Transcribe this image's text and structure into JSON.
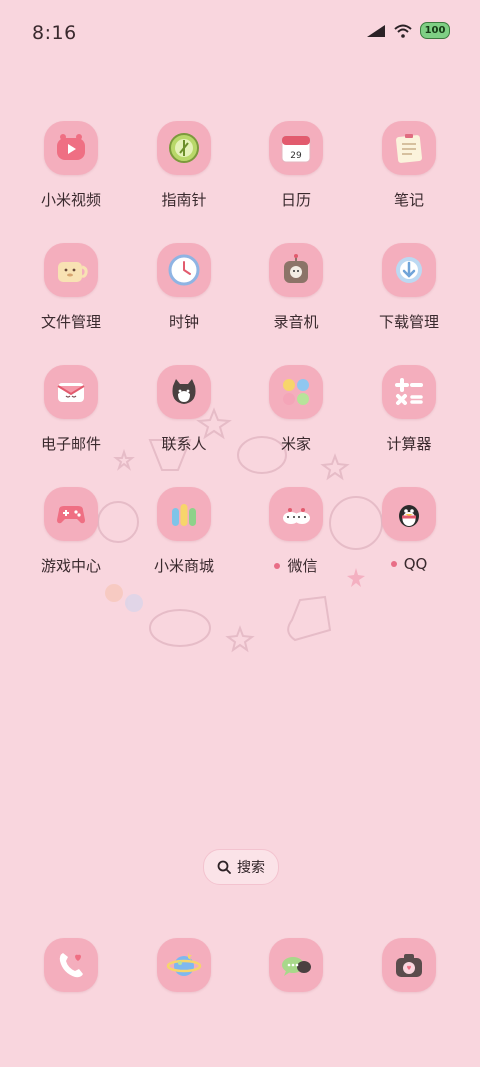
{
  "status_bar": {
    "time": "8:16",
    "battery": "100"
  },
  "apps": [
    {
      "label": "小米视频",
      "icon": "video-icon"
    },
    {
      "label": "指南针",
      "icon": "compass-icon"
    },
    {
      "label": "日历",
      "icon": "calendar-icon",
      "date": "29"
    },
    {
      "label": "笔记",
      "icon": "notes-icon"
    },
    {
      "label": "文件管理",
      "icon": "folder-icon"
    },
    {
      "label": "时钟",
      "icon": "clock-icon"
    },
    {
      "label": "录音机",
      "icon": "recorder-icon"
    },
    {
      "label": "下载管理",
      "icon": "download-icon"
    },
    {
      "label": "电子邮件",
      "icon": "mail-icon"
    },
    {
      "label": "联系人",
      "icon": "contacts-icon"
    },
    {
      "label": "米家",
      "icon": "mihome-icon"
    },
    {
      "label": "计算器",
      "icon": "calculator-icon"
    },
    {
      "label": "游戏中心",
      "icon": "gamepad-icon"
    },
    {
      "label": "小米商城",
      "icon": "mall-icon"
    },
    {
      "label": "微信",
      "icon": "wechat-icon",
      "new_indicator": true
    },
    {
      "label": "QQ",
      "icon": "qq-icon",
      "new_indicator": true
    }
  ],
  "search": {
    "label": "搜索"
  },
  "dock": [
    {
      "icon": "phone-icon"
    },
    {
      "icon": "browser-icon"
    },
    {
      "icon": "messages-icon"
    },
    {
      "icon": "camera-icon"
    }
  ],
  "colors": {
    "background": "#f9d6de",
    "tile": "#f4aebd",
    "indicator_dot": "#e86d86"
  }
}
